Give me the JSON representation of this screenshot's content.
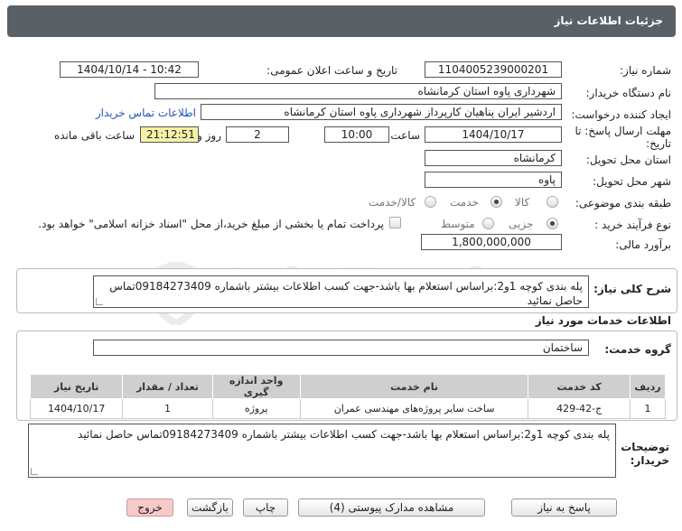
{
  "header": {
    "title": "جزئیات اطلاعات نیاز"
  },
  "watermark": {
    "text": "AriaTender.net"
  },
  "form": {
    "need_number_label": "شماره نیاز:",
    "need_number": "1104005239000201",
    "announce_label": "تاریخ و ساعت اعلان عمومی:",
    "announce_value": "1404/10/14 - 10:42",
    "buyer_org_label": "نام دستگاه خریدار:",
    "buyer_org": "شهرداری پاوه استان کرمانشاه",
    "creator_label": "ایجاد کننده درخواست:",
    "creator": "اردشیر ایران پناهیان کارپرداز شهرداری پاوه استان کرمانشاه",
    "contact_link": "اطلاعات تماس خریدار",
    "deadline_label": "مهلت ارسال پاسخ: تا تاریخ:",
    "deadline_date": "1404/10/17",
    "time_label": "ساعت",
    "deadline_time": "10:00",
    "days_value": "2",
    "days_label": "روز و",
    "remaining_time": "21:12:51",
    "remaining_label": "ساعت باقی مانده",
    "province_label": "استان محل تحویل:",
    "province": "کرمانشاه",
    "city_label": "شهر محل تحویل:",
    "city": "پاوه",
    "category_label": "طبقه بندی موضوعی:",
    "category_options": [
      "کالا",
      "خدمت",
      "کالا/خدمت"
    ],
    "category_selected": "خدمت",
    "process_label": "نوع فرآیند خرید :",
    "process_options": [
      "جزیی",
      "متوسط"
    ],
    "process_selected": "جزیی",
    "payment_note": "پرداخت تمام یا بخشی از مبلغ خرید،از محل \"اسناد خزانه اسلامی\" خواهد بود.",
    "budget_label": "برآورد مالی:",
    "budget": "1,800,000,000"
  },
  "description": {
    "label": "شرح کلی نیاز:",
    "text": "پله بندی کوچه 1و2:براساس استعلام بها باشد-جهت کسب اطلاعات بیشتر باشماره 09184273409تماس حاصل نمائید"
  },
  "services": {
    "section_title": "اطلاعات خدمات مورد نیاز",
    "group_label": "گروه خدمت:",
    "group_value": "ساختمان",
    "columns": [
      "ردیف",
      "کد خدمت",
      "نام خدمت",
      "واحد اندازه گیری",
      "تعداد / مقدار",
      "تاریخ نیاز"
    ],
    "rows": [
      [
        "1",
        "ج-42-429",
        "ساخت سایر پروژه‌های مهندسی عمران",
        "پروژه",
        "1",
        "1404/10/17"
      ]
    ]
  },
  "buyer_notes": {
    "label": "توضیحات خریدار:",
    "text": "پله بندی کوچه 1و2:براساس استعلام بها باشد-جهت کسب اطلاعات بیشتر باشماره 09184273409تماس حاصل نمائید"
  },
  "buttons": {
    "reply": "پاسخ به نیاز",
    "attachments": "مشاهده مدارک پیوستی (4)",
    "print": "چاپ",
    "back": "بازگشت",
    "exit": "خروج"
  },
  "colors": {
    "header_bg": "#5a6166",
    "remaining_bg": "#f6f1a5",
    "exit_bg": "#f8c9c9",
    "link": "#2255bb"
  }
}
